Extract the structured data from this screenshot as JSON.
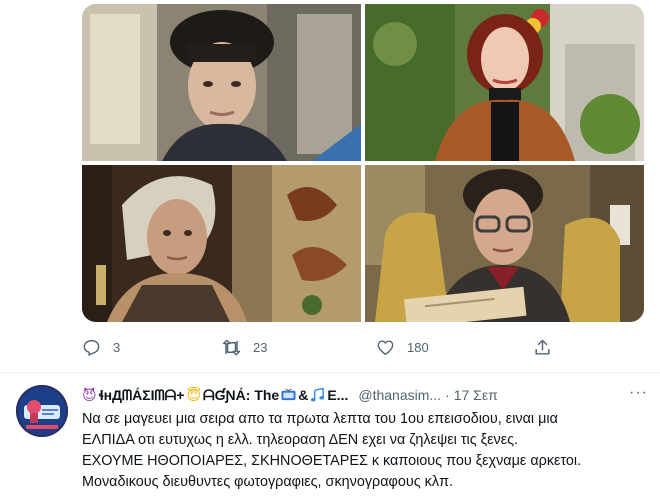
{
  "media": {
    "photos": [
      {
        "name": "photo-woman-dark-hair-portrait",
        "alt": ""
      },
      {
        "name": "photo-woman-brown-coat-garden",
        "alt": ""
      },
      {
        "name": "photo-woman-headscarf-interior",
        "alt": ""
      },
      {
        "name": "photo-woman-glasses-reading",
        "alt": ""
      }
    ]
  },
  "actions": {
    "reply_count": "3",
    "retweet_count": "23",
    "like_count": "180"
  },
  "tweet2": {
    "name_part1": "ɬнДᗰÁƩIᗰᗩ+",
    "name_part2": "ᗩƓƝÁ: The",
    "name_part3": "&",
    "name_part4": "E...",
    "handle": "@thanasim...",
    "separator": "·",
    "time": "17 Σεπ",
    "more": "···",
    "lines": [
      "Να σε μαγευει μια σειρα απο τα πρωτα λεπτα του 1ου επεισοδιου, ειναι μια",
      "ΕΛΠΙΔΑ οτι ευτυχως η ελλ. τηλεοραση ΔΕΝ εχει να ζηλεψει τις ξενες.",
      "ΕΧΟΥΜΕ ΗΘΟΠΟΙΑΡΕΣ, ΣΚΗΝΟΘΕΤΑΡΕΣ κ καποιους που ξεχναμε αρκετοι.",
      "Μοναδικους διευθυντες φωτογραφιες, σκηνογραφους κλπ."
    ]
  },
  "colors": {
    "text_primary": "#0f1419",
    "text_secondary": "#536471",
    "divider": "#eff3f4"
  }
}
